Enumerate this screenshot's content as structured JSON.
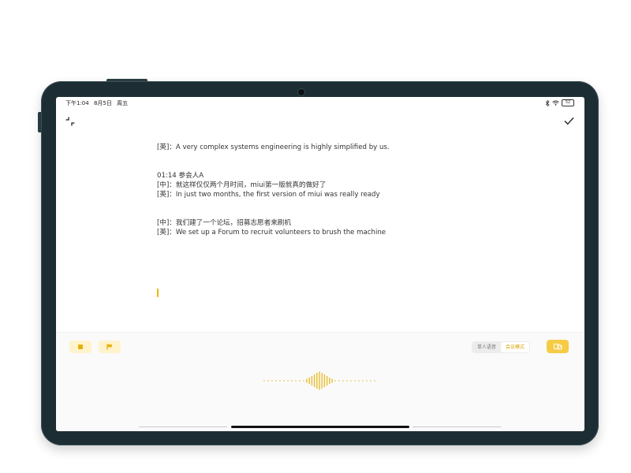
{
  "status_bar": {
    "time": "下午1:04",
    "date": "8月5日",
    "weekday": "周五",
    "battery": "52"
  },
  "transcript": {
    "lines": [
      "[英]：A very complex systems engineering is highly simplified by us.",
      "",
      "",
      "01:14  参会人A",
      "[中]：就这样仅仅两个月时间，miui第一版就真的做好了",
      "[英]：In just two months, the first version of miui was really ready",
      "",
      "",
      "[中]：我们建了一个论坛，招募志愿者来刷机",
      "[英]：We set up a Forum to recruit volunteers to brush the machine"
    ]
  },
  "controls": {
    "mode_options": [
      "单人语音",
      "会议模式"
    ],
    "active_mode": "会议模式"
  },
  "theme": {
    "accent": "#f6cc45",
    "accent_text": "#d9a300",
    "accent_light": "#fff3cc",
    "frame": "#1c2e33"
  },
  "icons": {
    "collapse": "collapse-icon",
    "confirm": "check-icon",
    "stop": "stop-icon",
    "flag": "flag-icon",
    "translate": "translate-icon",
    "bluetooth": "bluetooth-icon",
    "wifi": "wifi-icon"
  }
}
